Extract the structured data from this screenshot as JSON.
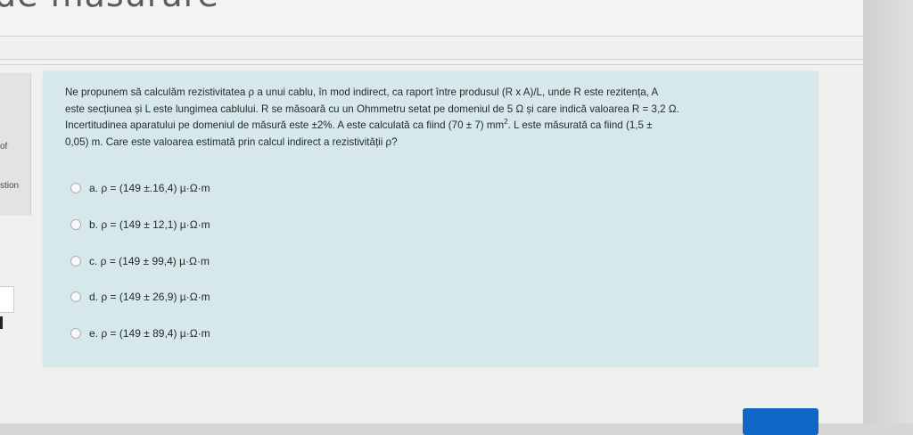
{
  "header": {
    "page_heading": "de măsurare"
  },
  "sidebar": {
    "info_of": "of",
    "info_question": "stion"
  },
  "question": {
    "text_line_1": "Ne propunem să calculăm rezistivitatea ρ a unui cablu, în mod indirect, ca raport între produsul  (R x A)/L, unde R este rezitența, A",
    "text_line_2": "este secțiunea și L este lungimea cablului. R se măsoară cu un Ohmmetru setat pe domeniul de 5 Ω și care indică valoarea R = 3,2 Ω.",
    "text_line_3a": "Incertitudinea aparatului pe domeniul de măsură este ±2%. A este calculată ca fiind (70 ± 7) mm",
    "text_line_3_sup": "2",
    "text_line_3b": ". L este măsurată ca fiind (1,5 ±",
    "text_line_4": "0,05) m. Care este valoarea estimată prin calcul indirect a rezistivității ρ?",
    "options": [
      {
        "label": "a. ρ = (149 ±.16,4) µ·Ω·m"
      },
      {
        "label": "b. ρ = (149 ± 12,1) µ·Ω·m"
      },
      {
        "label": "c. ρ = (149 ± 99,4) µ·Ω·m"
      },
      {
        "label": "d. ρ = (149 ± 26,9) µ·Ω·m"
      },
      {
        "label": "e. ρ = (149 ± 89,4) µ·Ω·m"
      }
    ]
  },
  "footer": {
    "next_button_label": ""
  },
  "colors": {
    "card_background": "#d7e8eb",
    "primary_button": "#0f67c5"
  }
}
